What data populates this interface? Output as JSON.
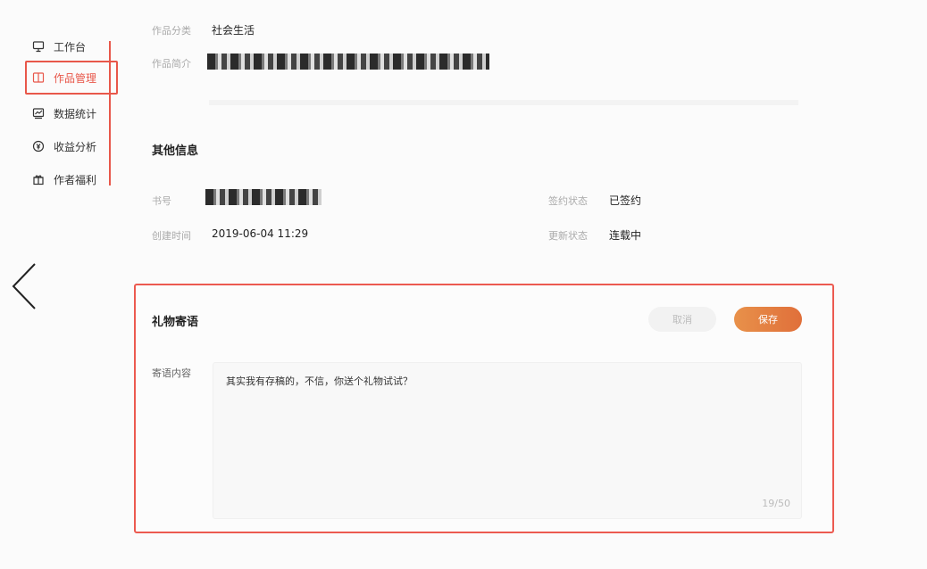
{
  "sidebar": {
    "items": [
      {
        "label": "工作台",
        "icon": "monitor-icon"
      },
      {
        "label": "作品管理",
        "icon": "book-icon"
      },
      {
        "label": "数据统计",
        "icon": "chart-icon"
      },
      {
        "label": "收益分析",
        "icon": "yen-icon"
      },
      {
        "label": "作者福利",
        "icon": "gift-icon"
      }
    ],
    "active_index": 1
  },
  "work": {
    "category_label": "作品分类",
    "category_value": "社会生活",
    "intro_label": "作品简介"
  },
  "other_info": {
    "title": "其他信息",
    "book_no_label": "书号",
    "sign_status_label": "签约状态",
    "sign_status_value": "已签约",
    "created_label": "创建时间",
    "created_value": "2019-06-04 11:29",
    "update_status_label": "更新状态",
    "update_status_value": "连载中"
  },
  "gift": {
    "title": "礼物寄语",
    "cancel_label": "取消",
    "save_label": "保存",
    "content_label": "寄语内容",
    "content_text": "其实我有存稿的，不信，你送个礼物试试？",
    "char_count": "19/50"
  },
  "colors": {
    "accent": "#e8574a",
    "save_button": "#e0823f"
  }
}
